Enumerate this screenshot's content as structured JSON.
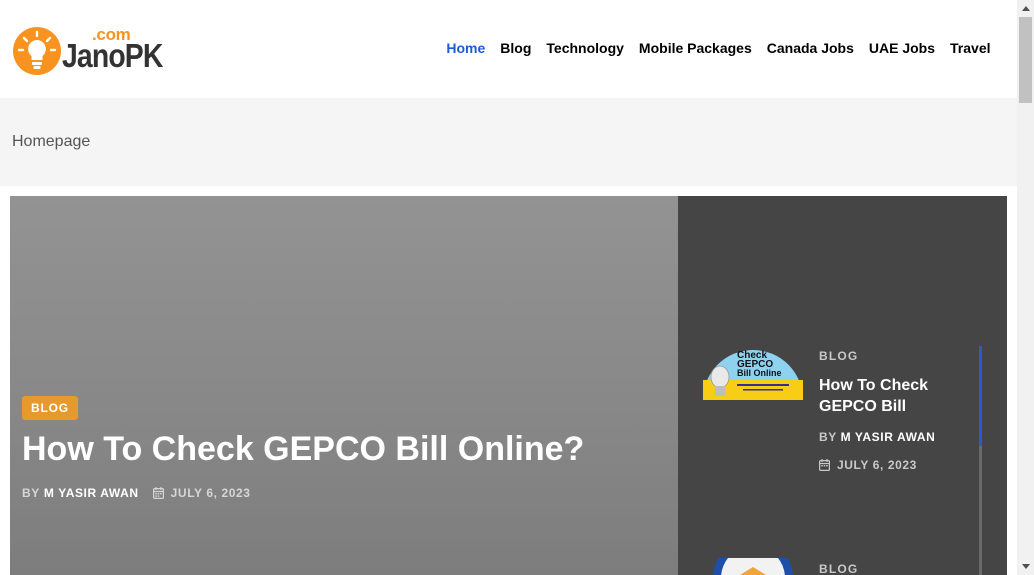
{
  "logo": {
    "domain": ".com",
    "name_part1": "Jano",
    "name_part2": "PK"
  },
  "nav": {
    "items": [
      "Home",
      "Blog",
      "Technology",
      "Mobile Packages",
      "Canada Jobs",
      "UAE Jobs",
      "Travel"
    ],
    "active": "Home",
    "active_color": "#1e5cd6"
  },
  "breadcrumb": {
    "label": "Homepage"
  },
  "hero": {
    "badge": "BLOG",
    "badge_color": "#e59a2b",
    "title": "How To Check GEPCO Bill Online?",
    "by": "BY",
    "author": "M YASIR AWAN",
    "date": "JULY 6, 2023"
  },
  "side": {
    "items": [
      {
        "category": "BLOG",
        "title": "How To Check GEPCO Bill",
        "by": "BY",
        "author": "M YASIR AWAN",
        "date": "JULY 6, 2023",
        "thumb_text": [
          "Check",
          "GEPCO",
          "Bill Online"
        ]
      },
      {
        "category": "BLOG"
      }
    ],
    "accent_color": "#2f56d4"
  }
}
